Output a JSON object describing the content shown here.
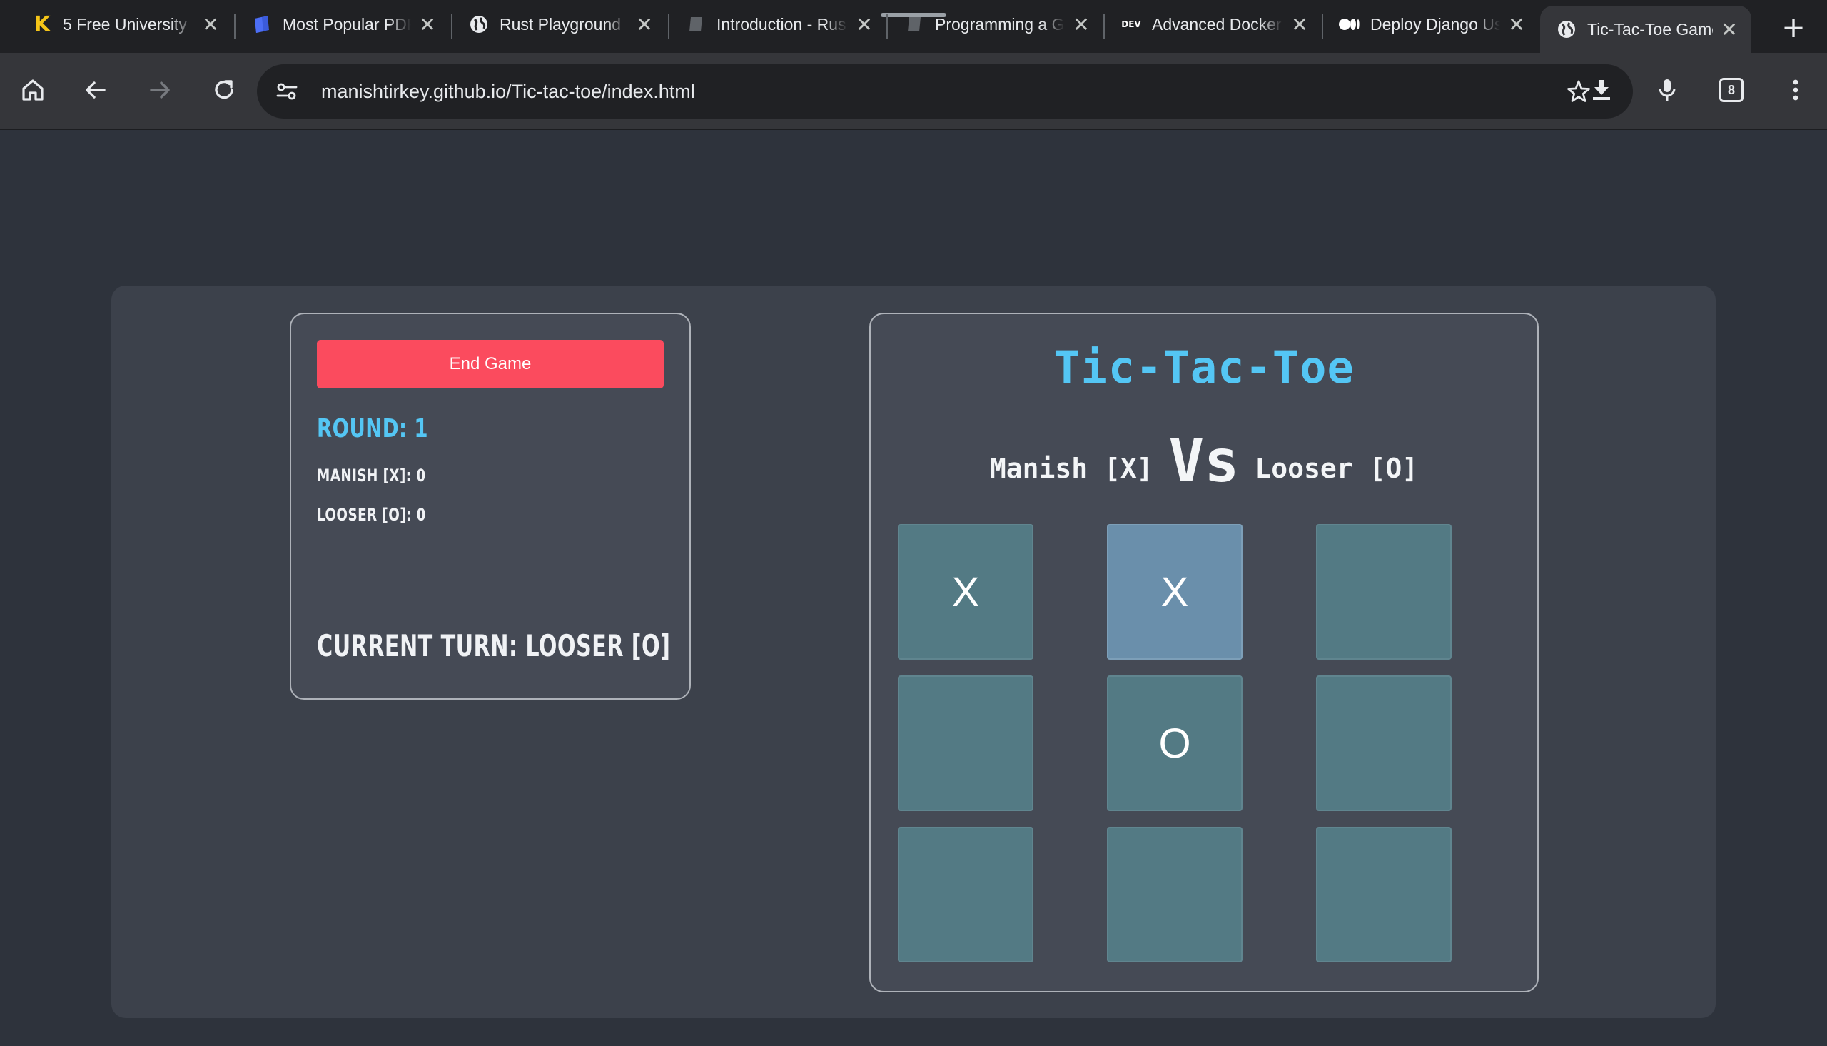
{
  "browser": {
    "tabs": [
      {
        "title": "5 Free University",
        "favicon": "k-logo-icon",
        "active": false
      },
      {
        "title": "Most Popular PDF",
        "favicon": "pdf-logo-icon",
        "active": false
      },
      {
        "title": "Rust Playground",
        "favicon": "globe-icon",
        "active": false
      },
      {
        "title": "Introduction - Rus",
        "favicon": "book-icon",
        "active": false
      },
      {
        "title": "Programming a G",
        "favicon": "book-icon",
        "active": false
      },
      {
        "title": "Advanced Docker",
        "favicon": "dev-logo-icon",
        "active": false
      },
      {
        "title": "Deploy Django Us",
        "favicon": "medium-logo-icon",
        "active": false
      },
      {
        "title": "Tic-Tac-Toe Game",
        "favicon": "globe-icon",
        "active": true
      }
    ],
    "dev_badge": "DEV",
    "k_badge": "K",
    "url": "manishtirkey.github.io/Tic-tac-toe/index.html",
    "tab_count": "8"
  },
  "game": {
    "end_button": "End Game",
    "round": "ROUND: 1",
    "score_player1": "MANISH [X]: 0",
    "score_player2": "LOOSER [O]: 0",
    "current_turn": "CURRENT TURN: LOOSER [O]",
    "title": "Tic-Tac-Toe",
    "player1": "Manish [X]",
    "vs": "Vs",
    "player2": "Looser [O]",
    "board": [
      "X",
      "X",
      "",
      "",
      "O",
      "",
      "",
      "",
      ""
    ],
    "hovered_cell": 2
  },
  "colors": {
    "accent": "#54c6f4",
    "end_button": "#fb4b5e",
    "cell": "#537a84",
    "cell_hover": "#6a8fab",
    "panel": "#454a55",
    "background": "#2e333c"
  }
}
